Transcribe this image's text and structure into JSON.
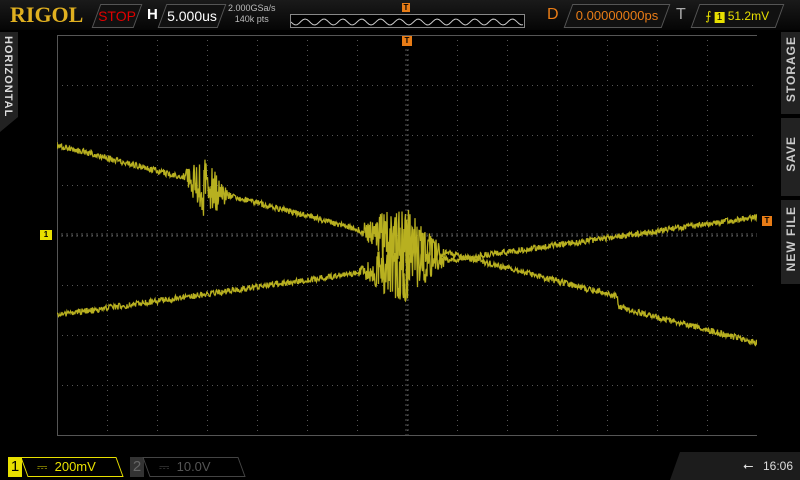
{
  "header": {
    "brand": "RIGOL",
    "run_state": "STOP",
    "h_label": "H",
    "timebase": "5.000us",
    "sample_rate": "2.000GSa/s",
    "memory_depth": "140k pts",
    "trigger_marker": "T",
    "delay_label": "D",
    "delay": "0.00000000ps",
    "trigger_label": "T",
    "trigger_source": "1",
    "trigger_level": "51.2mV"
  },
  "side_menu": {
    "left": "HORIZONTAL",
    "right": [
      "STORAGE",
      "SAVE",
      "NEW FILE"
    ]
  },
  "markers": {
    "ch1": "1",
    "trigger_level": "T",
    "trigger_position": "T"
  },
  "footer": {
    "ch1_num": "1",
    "ch1_coupling": "⎓",
    "ch1_scale": "200mV",
    "ch2_num": "2",
    "ch2_coupling": "⎓",
    "ch2_scale": "10.0V",
    "time": "16:06",
    "usb_icon": "⭠"
  },
  "colors": {
    "ch1": "#e8e000",
    "trace": "#b8b020",
    "trigger": "#e87c16",
    "stop": "#e00000"
  }
}
